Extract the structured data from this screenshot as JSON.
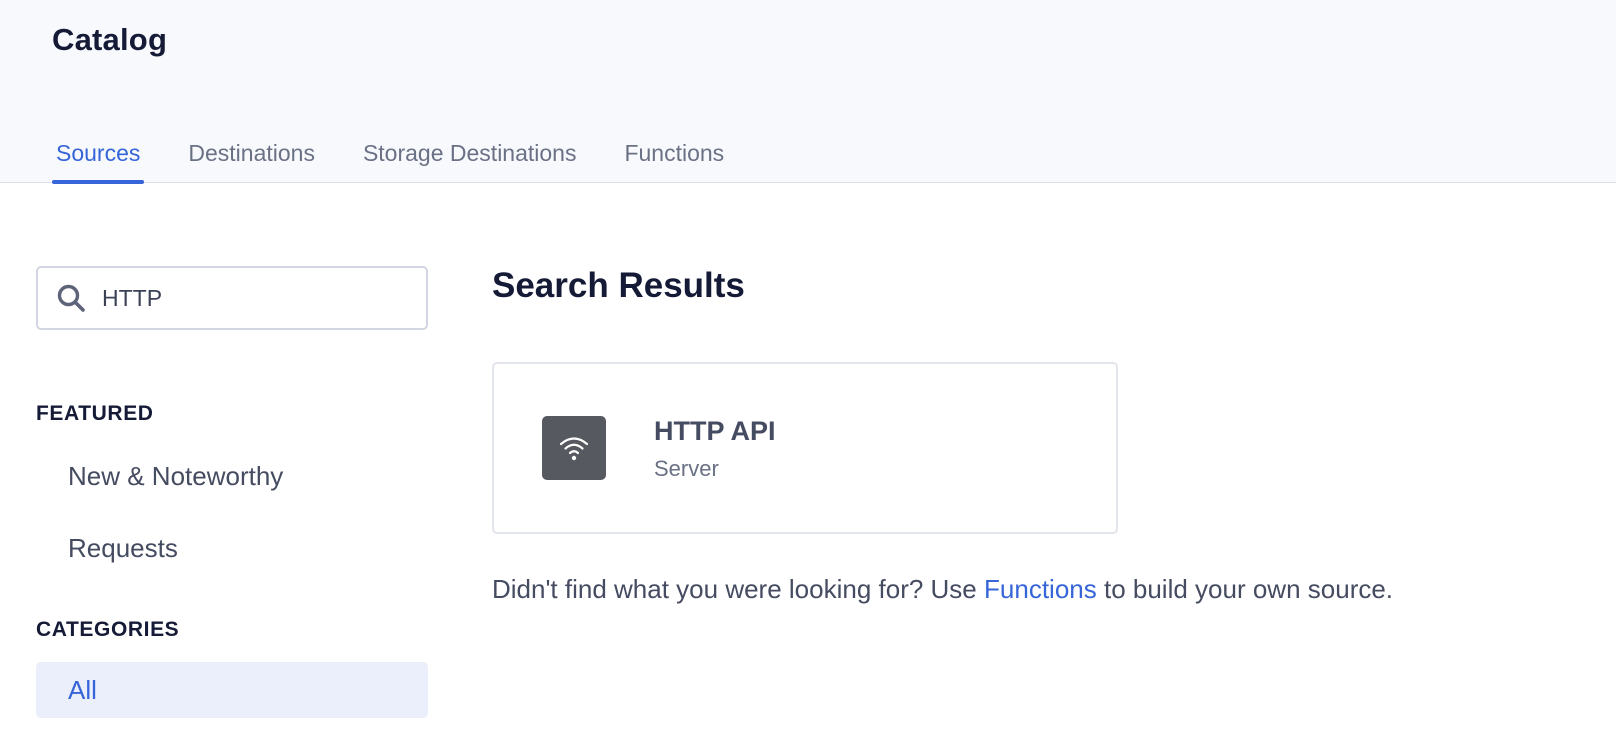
{
  "header": {
    "title": "Catalog",
    "tabs": [
      {
        "label": "Sources",
        "active": true
      },
      {
        "label": "Destinations",
        "active": false
      },
      {
        "label": "Storage Destinations",
        "active": false
      },
      {
        "label": "Functions",
        "active": false
      }
    ]
  },
  "sidebar": {
    "search": {
      "value": "HTTP",
      "icon": "search-icon"
    },
    "featured_heading": "FEATURED",
    "featured_items": [
      {
        "label": "New & Noteworthy"
      },
      {
        "label": "Requests"
      }
    ],
    "categories_heading": "CATEGORIES",
    "category_items": [
      {
        "label": "All",
        "active": true
      }
    ]
  },
  "main": {
    "results_title": "Search Results",
    "results": [
      {
        "name": "HTTP API",
        "type": "Server",
        "icon": "wifi-icon"
      }
    ],
    "help": {
      "prefix": "Didn't find what you were looking for? Use",
      "link": "Functions",
      "suffix": "to build your own source."
    }
  },
  "colors": {
    "accent": "#3565d8",
    "header_bg": "#f8f9fd",
    "active_item_bg": "#ebeefb",
    "logo_bg": "#56595f"
  }
}
